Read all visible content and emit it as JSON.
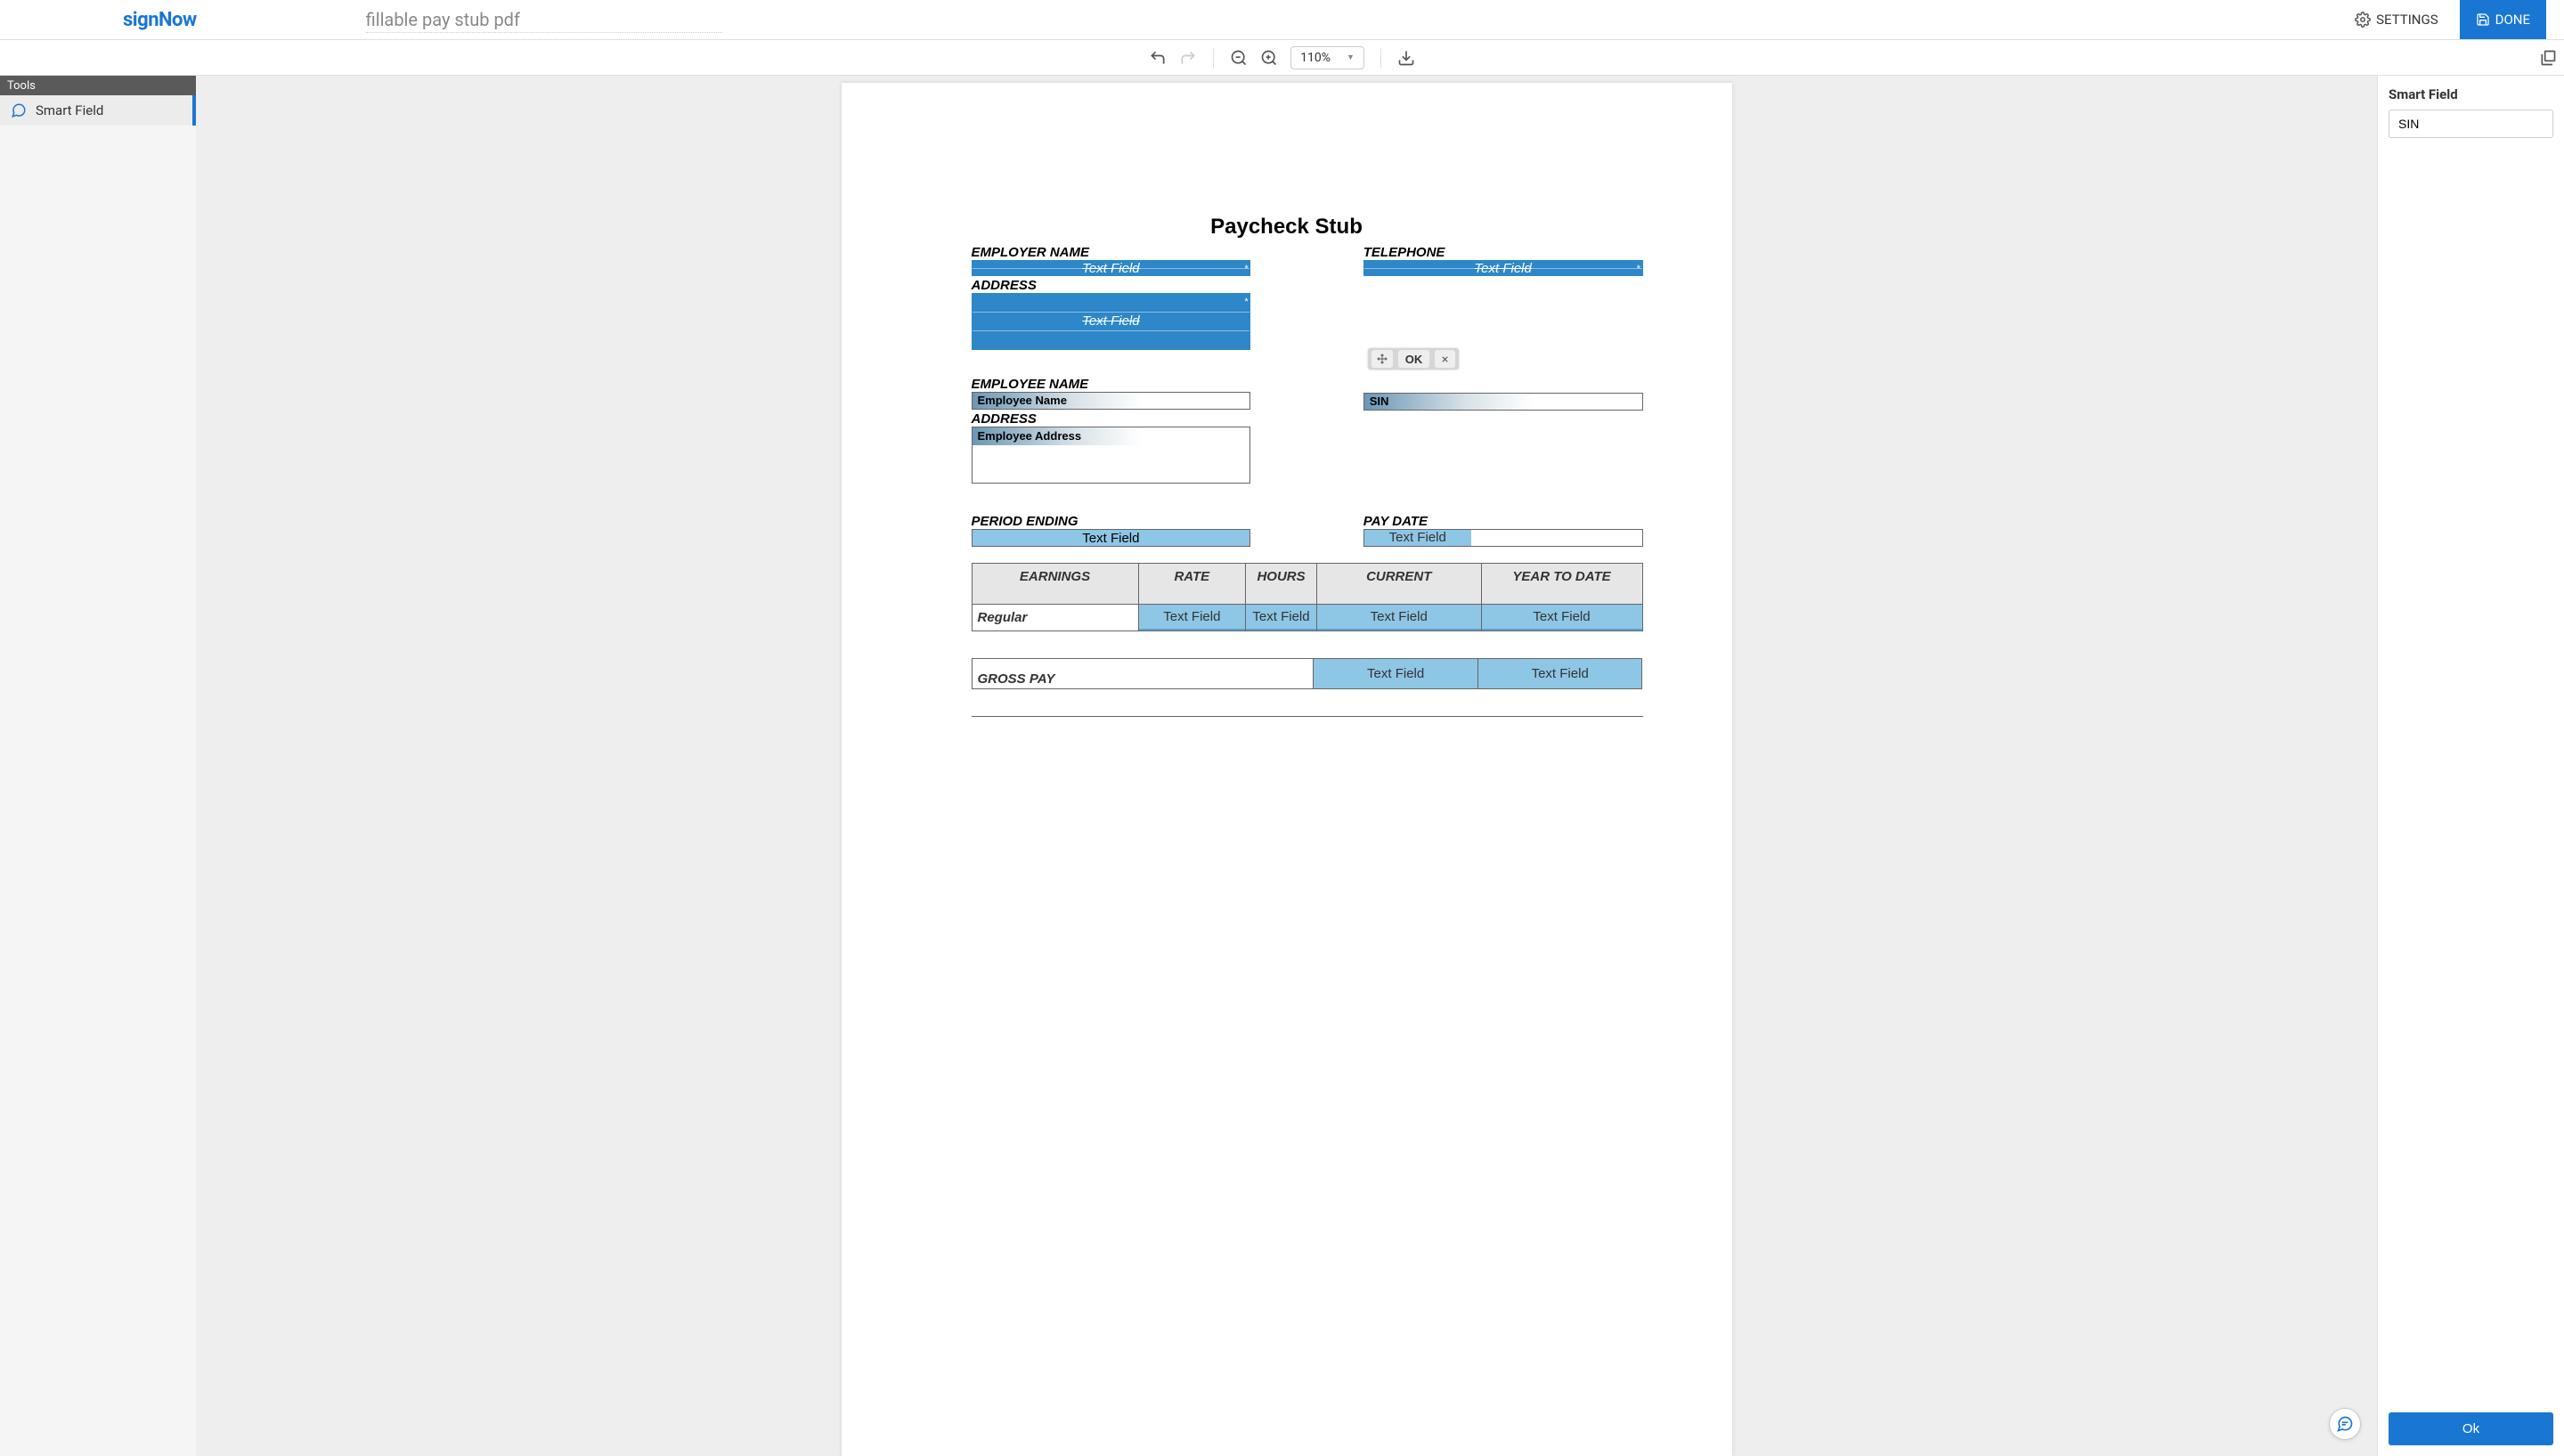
{
  "header": {
    "logo": "signNow",
    "documentName": "fillable pay stub pdf",
    "settingsLabel": "SETTINGS",
    "doneLabel": "DONE"
  },
  "toolbar": {
    "zoomLevel": "110%"
  },
  "leftPanel": {
    "toolsHeader": "Tools",
    "smartFieldLabel": "Smart Field"
  },
  "rightPanel": {
    "title": "Smart Field",
    "inputValue": "SIN",
    "okLabel": "Ok"
  },
  "fieldToolbar": {
    "okLabel": "OK"
  },
  "document": {
    "title": "Paycheck Stub",
    "labels": {
      "employerName": "EMPLOYER NAME",
      "telephone": "TELEPHONE",
      "addressEmployer": "ADDRESS",
      "employeeName": "EMPLOYEE NAME",
      "addressEmployee": "ADDRESS",
      "periodEnding": "PERIOD ENDING",
      "payDate": "PAY DATE",
      "grossPay": "GROSS PAY"
    },
    "placeholders": {
      "textField": "Text Field",
      "employeeName": "Employee Name",
      "employeeAddress": "Employee Address",
      "sin": "SIN"
    },
    "table": {
      "headers": {
        "earnings": "EARNINGS",
        "rate": "RATE",
        "hours": "HOURS",
        "current": "CURRENT",
        "ytd": "YEAR TO DATE"
      },
      "rowLabel": "Regular"
    }
  }
}
